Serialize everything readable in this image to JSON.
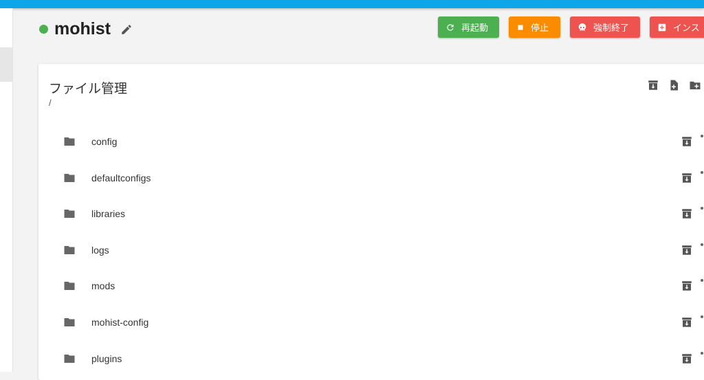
{
  "server": {
    "name": "mohist",
    "status_color": "#4caf50"
  },
  "actions": {
    "restart_label": "再起動",
    "stop_label": "停止",
    "kill_label": "強制終了",
    "install_label": "インス"
  },
  "file_manager": {
    "title": "ファイル管理",
    "path": "/",
    "items": [
      {
        "name": "config",
        "type": "folder"
      },
      {
        "name": "defaultconfigs",
        "type": "folder"
      },
      {
        "name": "libraries",
        "type": "folder"
      },
      {
        "name": "logs",
        "type": "folder"
      },
      {
        "name": "mods",
        "type": "folder"
      },
      {
        "name": "mohist-config",
        "type": "folder"
      },
      {
        "name": "plugins",
        "type": "folder"
      }
    ]
  },
  "colors": {
    "accent_bar": "#0ea5e9",
    "restart": "#4caf50",
    "stop": "#fb8c00",
    "danger": "#ef5350"
  }
}
